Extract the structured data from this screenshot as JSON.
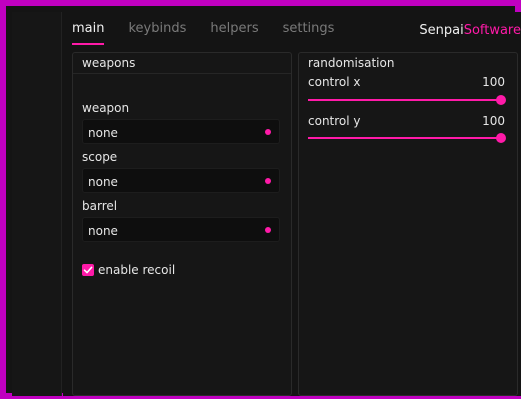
{
  "tabs": [
    {
      "label": "main",
      "active": true
    },
    {
      "label": "keybinds",
      "active": false
    },
    {
      "label": "helpers",
      "active": false
    },
    {
      "label": "settings",
      "active": false
    }
  ],
  "brand": {
    "part1": "Senpai",
    "part2": "Software"
  },
  "weapons_panel": {
    "title": "weapons",
    "fields": [
      {
        "label": "weapon",
        "value": "none"
      },
      {
        "label": "scope",
        "value": "none"
      },
      {
        "label": "barrel",
        "value": "none"
      }
    ],
    "enable_recoil": {
      "label": "enable recoil",
      "checked": true
    }
  },
  "randomisation_panel": {
    "title": "randomisation",
    "sliders": [
      {
        "label": "control x",
        "value": "100",
        "fraction": 1.0
      },
      {
        "label": "control y",
        "value": "100",
        "fraction": 1.0
      }
    ]
  },
  "colors": {
    "accent": "#ff1aa8",
    "border": "#c000c0",
    "background": "#141414"
  }
}
